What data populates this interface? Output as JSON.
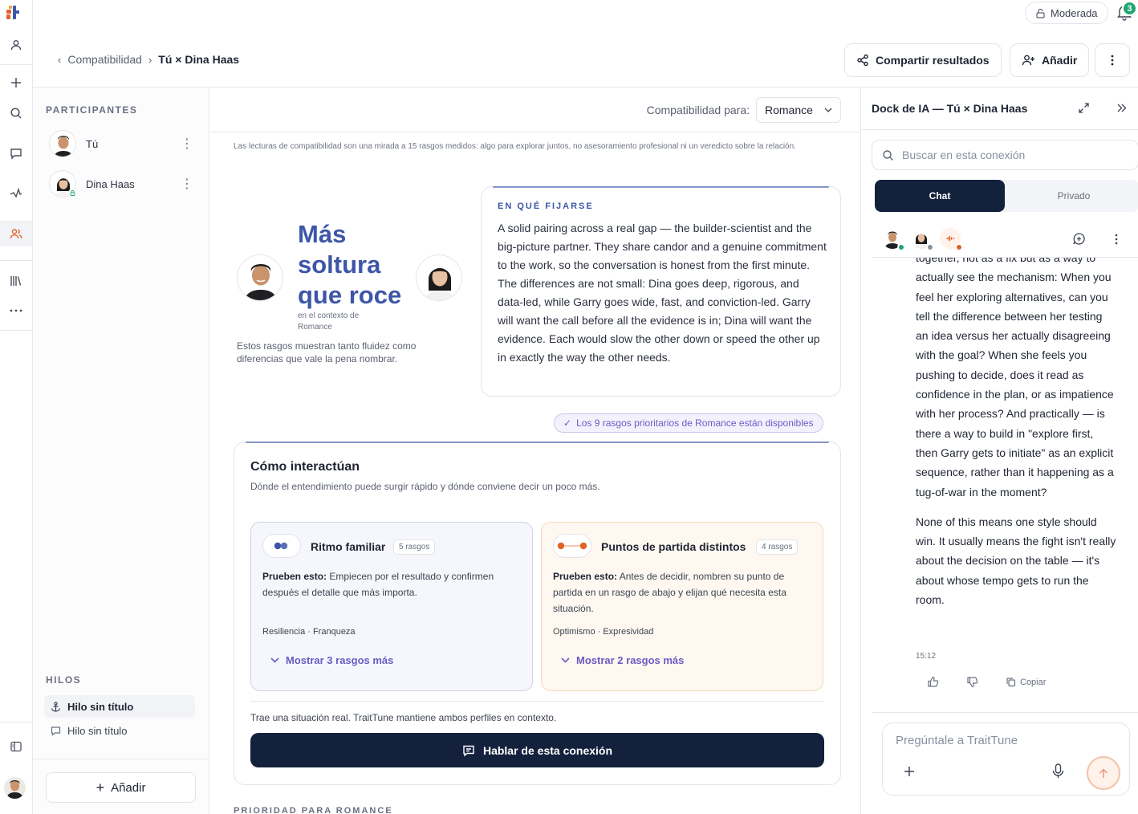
{
  "topbar": {
    "moderation_label": "Moderada",
    "notif_count": "3",
    "breadcrumb_parent": "Compatibilidad",
    "breadcrumb_current": "Tú × Dina Haas",
    "share_label": "Compartir resultados",
    "add_label": "Añadir"
  },
  "sidebar": {
    "participants_heading": "PARTICIPANTES",
    "participants": [
      {
        "name": "Tú"
      },
      {
        "name": "Dina Haas"
      }
    ],
    "threads_heading": "HILOS",
    "threads": [
      {
        "label": "Hilo sin título"
      },
      {
        "label": "Hilo sin título"
      }
    ],
    "add_label": "Añadir"
  },
  "main": {
    "compat_for_label": "Compatibilidad para:",
    "compat_for_value": "Romance",
    "disclaimer": "Las lecturas de compatibilidad son una mirada a 15 rasgos medidos: algo para explorar juntos, no asesoramiento profesional ni un veredicto sobre la relación.",
    "hero_title": "Más soltura que roce",
    "hero_context": "en el contexto de Romance",
    "hero_desc": "Estos rasgos muestran tanto fluidez como diferencias que vale la pena nombrar.",
    "watch_heading": "EN QUÉ FIJARSE",
    "watch_text": "A solid pairing across a real gap — the builder-scientist and the big-picture partner. They share candor and a genuine commitment to the work, so the conversation is honest from the first minute. The differences are not small: Dina goes deep, rigorous, and data-led, while Garry goes wide, fast, and conviction-led. Garry will want the call before all the evidence is in; Dina will want the evidence. Each would slow the other down or speed the other up in exactly the way the other needs.",
    "priority_chip": "Los 9 rasgos prioritarios de Romance están disponibles",
    "interact_heading": "Cómo interactúan",
    "interact_sub": "Dónde el entendimiento puede surgir rápido y dónde conviene decir un poco más.",
    "cards": [
      {
        "title": "Ritmo familiar",
        "badge": "5 rasgos",
        "try_label": "Prueben esto:",
        "try_text": "Empiecen por el resultado y confirmen después el detalle que más importa.",
        "traits": "Resiliencia · Franqueza",
        "more": "Mostrar 3 rasgos más"
      },
      {
        "title": "Puntos de partida distintos",
        "badge": "4 rasgos",
        "try_label": "Prueben esto:",
        "try_text": "Antes de decidir, nombren su punto de partida en un rasgo de abajo y elijan qué necesita esta situación.",
        "traits": "Optimismo · Expresividad",
        "more": "Mostrar 2 rasgos más"
      }
    ],
    "interact_footer": "Trae una situación real. TraitTune mantiene ambos perfiles en contexto.",
    "talk_button": "Hablar de esta conexión",
    "priority_heading": "PRIORIDAD PARA ROMANCE"
  },
  "dock": {
    "title": "Dock de IA — Tú × Dina Haas",
    "search_placeholder": "Buscar en esta conexión",
    "tab_chat": "Chat",
    "tab_private": "Privado",
    "message_top": "together, not as a fix but as a way to actually see the mechanism: When you feel her exploring alternatives, can you tell the difference between her testing an idea versus her actually disagreeing with the goal? When she feels you pushing to decide, does it read as confidence in the plan, or as impatience with her process? And practically — is there a way to build in \"explore first, then Garry gets to initiate\" as an explicit sequence, rather than it happening as a tug-of-war in the moment?",
    "message_bottom": "None of this means one style should win. It usually means the fight isn't really about the decision on the table — it's about whose tempo gets to run the room.",
    "timestamp": "15:12",
    "copy_label": "Copiar",
    "composer_placeholder": "Pregúntale a TraitTune"
  },
  "colors": {
    "accent_blue": "#3d56a8",
    "navy": "#14213d",
    "purple": "#6a5bc4",
    "orange": "#e0632a",
    "green": "#1ea672"
  }
}
